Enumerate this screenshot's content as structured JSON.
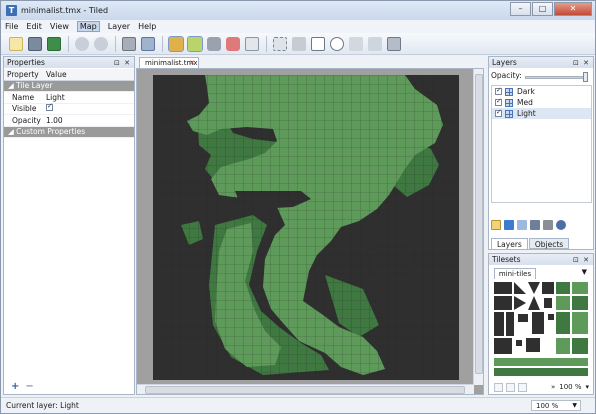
{
  "window": {
    "title": "minimalist.tmx - Tiled",
    "app_letter": "T",
    "min": "–",
    "max": "□",
    "close": "✕"
  },
  "menu": [
    "File",
    "Edit",
    "View",
    "Map",
    "Layer",
    "Help"
  ],
  "menu_active": "Map",
  "properties_panel": {
    "title": "Properties",
    "controls": "⊡ ✕",
    "col_property": "Property",
    "col_value": "Value",
    "group_tile_layer": "Tile Layer",
    "name_key": "Name",
    "name_value": "Light",
    "visible_key": "Visible",
    "opacity_key": "Opacity",
    "opacity_value": "1.00",
    "group_custom": "Custom Properties",
    "add": "+",
    "remove": "−"
  },
  "editor": {
    "tab_label": "minimalist.tmx",
    "tab_close": "✕"
  },
  "layers_panel": {
    "title": "Layers",
    "controls": "⊡ ✕",
    "opacity_label": "Opacity:",
    "opacity_level": 1.0,
    "layers": [
      {
        "name": "Dark",
        "visible": true,
        "selected": false
      },
      {
        "name": "Med",
        "visible": true,
        "selected": false
      },
      {
        "name": "Light",
        "visible": true,
        "selected": true
      }
    ],
    "tab_layers": "Layers",
    "tab_objects": "Objects"
  },
  "tilesets_panel": {
    "title": "Tilesets",
    "controls": "⊡ ✕",
    "tileset_tab": "mini-tiles",
    "dropdown_arrow": "▼",
    "zoom": "100 %"
  },
  "status": {
    "current_layer": "Current layer: Light",
    "zoom": "100 %",
    "zoom_arrow": "▼"
  },
  "colors": {
    "light_green": "#5e9b5a",
    "mid_green": "#3f7841",
    "dark_tile": "#2f2f2f",
    "grid": "#1e1e1e"
  }
}
